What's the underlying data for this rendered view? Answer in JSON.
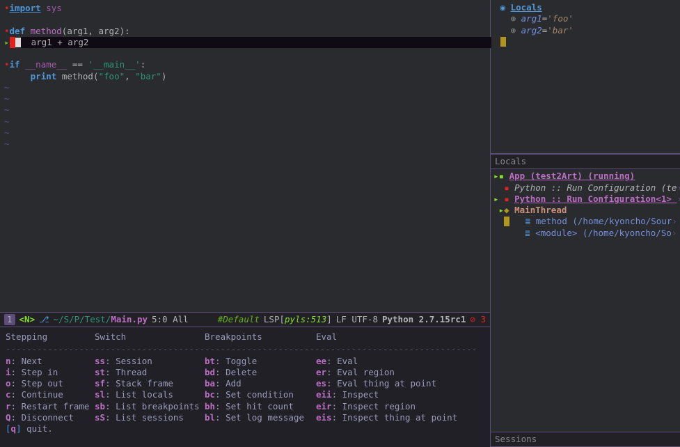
{
  "editor": {
    "lines": {
      "l1_import": "import",
      "l1_sys": "sys",
      "l3_def": "def",
      "l3_name": "method",
      "l3_args": "(arg1, arg2):",
      "l4_expr": "arg1 + arg2",
      "l6_if": "if",
      "l6_name": "__name__",
      "l6_eq": " == ",
      "l6_main": "'__main__'",
      "l6_colon": ":",
      "l7_print": "print",
      "l7_call": " method(",
      "l7_foo": "\"foo\"",
      "l7_comma": ", ",
      "l7_bar": "\"bar\"",
      "l7_close": ")"
    }
  },
  "modeline": {
    "window_num": "1",
    "state": "<N>",
    "branch_icon": "⎇",
    "path": "~/S/P/Test/",
    "file": "Main.py",
    "pos": "5:0 All",
    "tag": "#Default",
    "lsp": "LSP[",
    "lsp_server": "pyls:513",
    "lsp_close": "]",
    "encoding": "LF UTF-8",
    "python": "Python 2.7.15rc1",
    "err_count": "3"
  },
  "hydra": {
    "headers": {
      "step": "Stepping",
      "switch": "Switch",
      "bp": "Breakpoints",
      "eval": "Eval"
    },
    "step": [
      {
        "k": "n",
        "l": "Next"
      },
      {
        "k": "i",
        "l": "Step in"
      },
      {
        "k": "o",
        "l": "Step out"
      },
      {
        "k": "c",
        "l": "Continue"
      },
      {
        "k": "r",
        "l": "Restart frame"
      },
      {
        "k": "Q",
        "l": "Disconnect"
      }
    ],
    "switch": [
      {
        "k": "ss",
        "l": "Session"
      },
      {
        "k": "st",
        "l": "Thread"
      },
      {
        "k": "sf",
        "l": "Stack frame"
      },
      {
        "k": "sl",
        "l": "List locals"
      },
      {
        "k": "sb",
        "l": "List breakpoints"
      },
      {
        "k": "sS",
        "l": "List sessions"
      }
    ],
    "bp": [
      {
        "k": "bt",
        "l": "Toggle"
      },
      {
        "k": "bd",
        "l": "Delete"
      },
      {
        "k": "ba",
        "l": "Add"
      },
      {
        "k": "bc",
        "l": "Set condition"
      },
      {
        "k": "bh",
        "l": "Set hit count"
      },
      {
        "k": "bl",
        "l": "Set log message"
      }
    ],
    "eval": [
      {
        "k": "ee",
        "l": "Eval"
      },
      {
        "k": "er",
        "l": "Eval region"
      },
      {
        "k": "es",
        "l": "Eval thing at point"
      },
      {
        "k": "eii",
        "l": "Inspect"
      },
      {
        "k": "eir",
        "l": "Inspect region"
      },
      {
        "k": "eis",
        "l": "Inspect thing at point"
      }
    ],
    "quit_key": "q",
    "quit_label": " quit."
  },
  "locals": {
    "title": "Locals",
    "vars": [
      {
        "name": "arg1",
        "val": "'foo'"
      },
      {
        "name": "arg2",
        "val": "'bar'"
      }
    ],
    "pane_label": "Locals"
  },
  "sessions": {
    "pane_label": "Sessions",
    "app": "App (test2Art) (running)",
    "cfg1": "Python :: Run Configuration (te",
    "cfg2": "Python :: Run Configuration<1> ",
    "thread": "MainThread",
    "frame1": "method (/home/kyoncho/Sour",
    "frame2": "<module> (/home/kyoncho/So"
  }
}
